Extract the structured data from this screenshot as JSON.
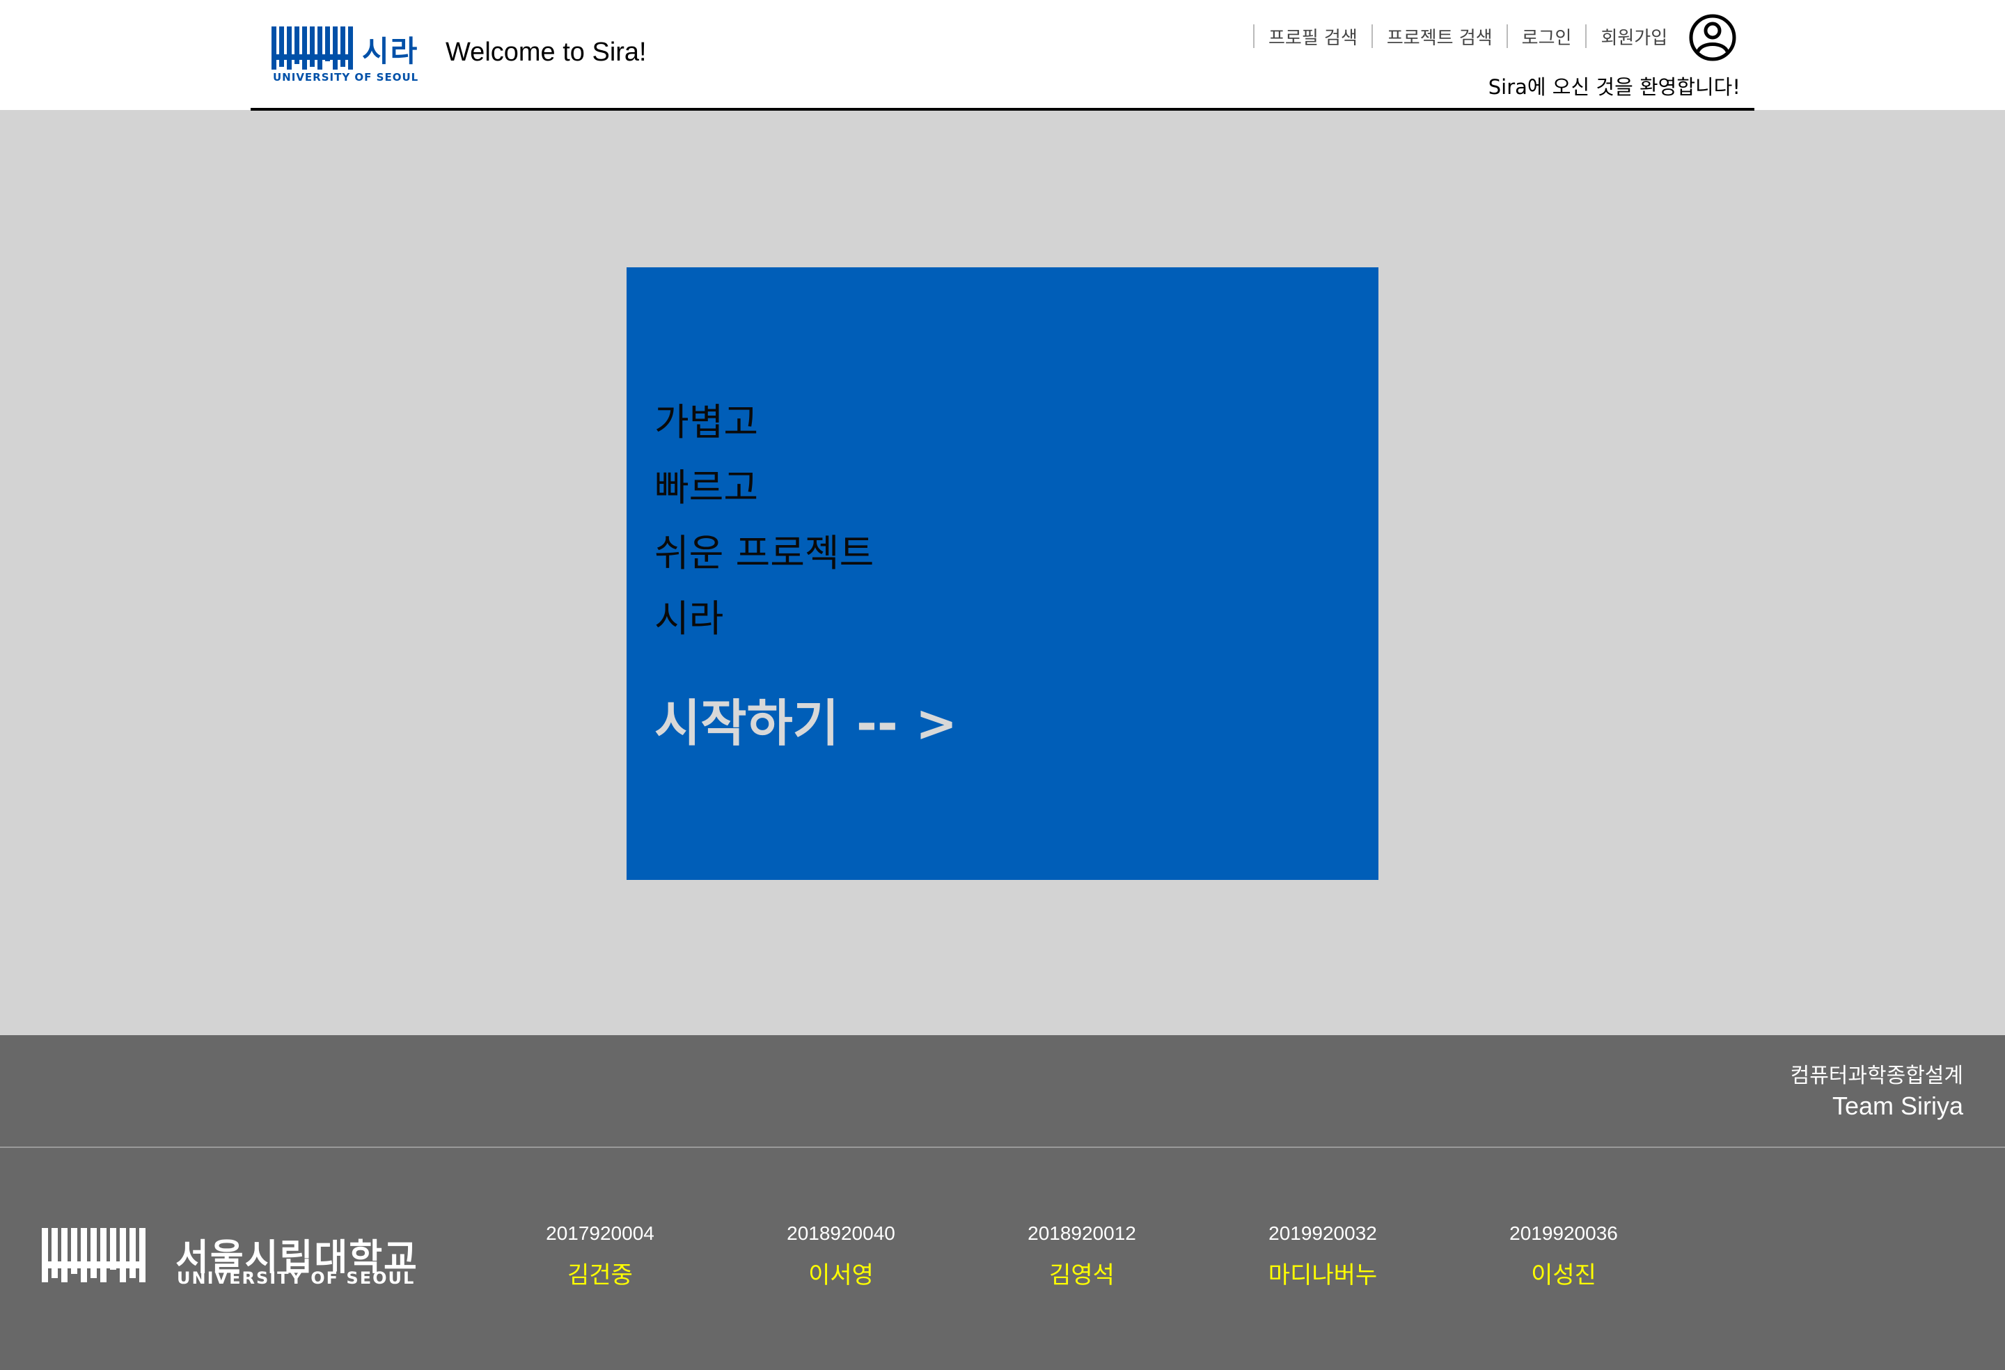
{
  "header": {
    "logo": {
      "korean": "시라",
      "english": "UNIVERSITY OF SEOUL"
    },
    "welcome": "Welcome to Sira!",
    "nav": [
      {
        "label": "프로필 검색"
      },
      {
        "label": "프로젝트 검색"
      },
      {
        "label": "로그인"
      },
      {
        "label": "회원가입"
      }
    ],
    "profile_icon": "user-circle-icon",
    "subtitle": "Sira에 오신 것을 환영합니다!"
  },
  "hero": {
    "lines": [
      "가볍고",
      "빠르고",
      "쉬운 프로젝트",
      "시라"
    ],
    "start_label": "시작하기 -- >",
    "background": "#005eb8"
  },
  "footer": {
    "course": "컴퓨터과학종합설계",
    "team": "Team Siriya",
    "university": {
      "korean": "서울시립대학교",
      "english": "UNIVERSITY OF SEOUL"
    },
    "members": [
      {
        "id": "2017920004",
        "name": "김건중"
      },
      {
        "id": "2018920040",
        "name": "이서영"
      },
      {
        "id": "2018920012",
        "name": "김영석"
      },
      {
        "id": "2019920032",
        "name": "마디나버누"
      },
      {
        "id": "2019920036",
        "name": "이성진"
      }
    ]
  },
  "colors": {
    "header_bg": "#ffffff",
    "page_bg": "#d3d3d3",
    "hero_bg": "#005eb8",
    "footer_bg": "#686868",
    "member_name": "#ffff00",
    "logo_blue": "#0050a8"
  }
}
